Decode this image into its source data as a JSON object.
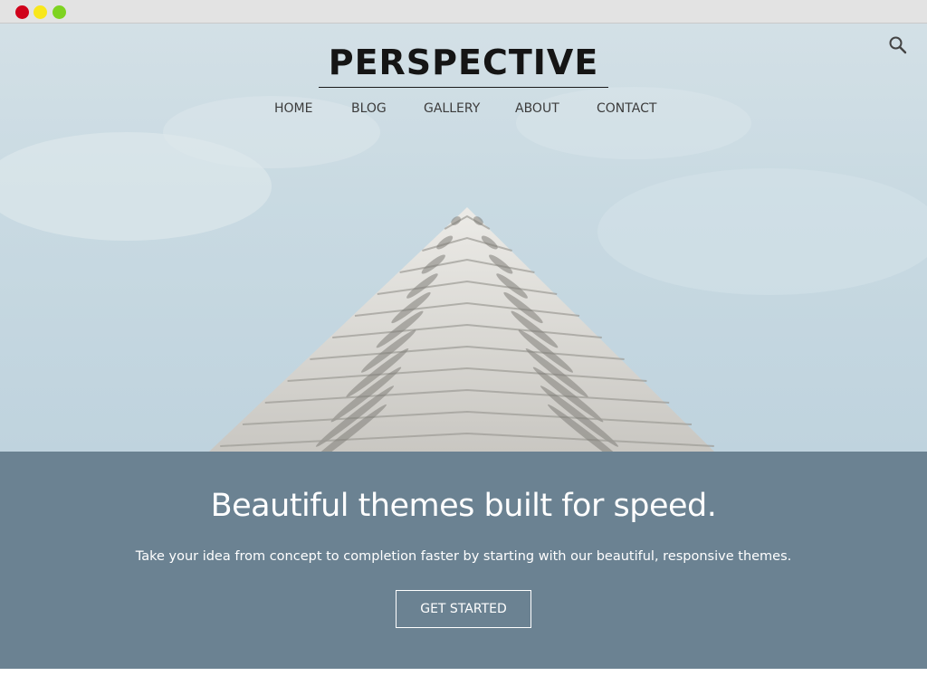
{
  "window": {
    "controls": [
      "close",
      "minimize",
      "maximize"
    ]
  },
  "header": {
    "brand": "PERSPECTIVE",
    "search_icon": "search-icon",
    "nav": [
      "HOME",
      "BLOG",
      "GALLERY",
      "ABOUT",
      "CONTACT"
    ]
  },
  "banner": {
    "headline": "Beautiful themes built for speed.",
    "subhead": "Take your idea from concept to completion faster by starting with our beautiful, responsive themes.",
    "cta_label": "GET STARTED"
  },
  "colors": {
    "banner_background": "#6b8292",
    "sky": "#c9dae2",
    "brand_text": "#151515",
    "nav_text": "#3c3c3c"
  }
}
